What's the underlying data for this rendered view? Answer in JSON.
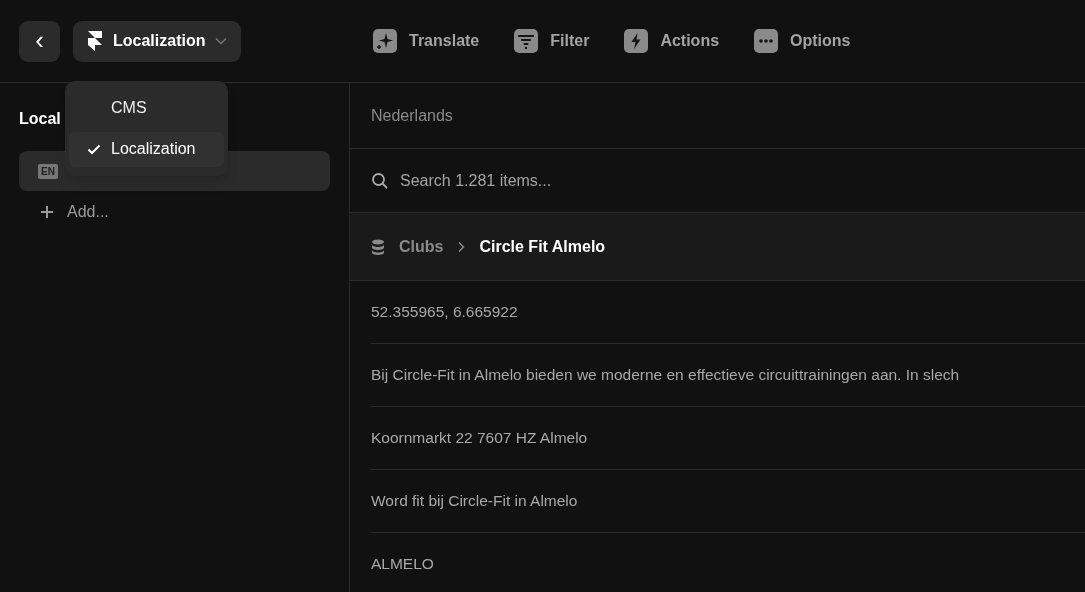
{
  "header": {
    "back": "‹",
    "project": {
      "label": "Localization"
    },
    "toolbar": [
      {
        "kind": "translate",
        "label": "Translate"
      },
      {
        "kind": "filter",
        "label": "Filter"
      },
      {
        "kind": "actions",
        "label": "Actions"
      },
      {
        "kind": "options",
        "label": "Options"
      }
    ]
  },
  "menu": {
    "items": [
      {
        "label": "CMS",
        "selected": false
      },
      {
        "label": "Localization",
        "selected": true
      }
    ]
  },
  "sidebar": {
    "title": "Local",
    "items": [
      {
        "badge": "EN",
        "selected": true
      }
    ],
    "add": "Add..."
  },
  "main": {
    "locale": "Nederlands",
    "search": {
      "placeholder": "Search 1.281 items..."
    },
    "breadcrumb": [
      "Clubs",
      "Circle Fit Almelo"
    ],
    "rows": [
      "52.355965, 6.665922",
      "Bij Circle-Fit in Almelo bieden we moderne en effectieve circuittrainingen aan. In slech",
      "Koornmarkt 22 7607 HZ Almelo",
      "Word fit bij Circle-Fit in Almelo",
      "ALMELO"
    ]
  }
}
